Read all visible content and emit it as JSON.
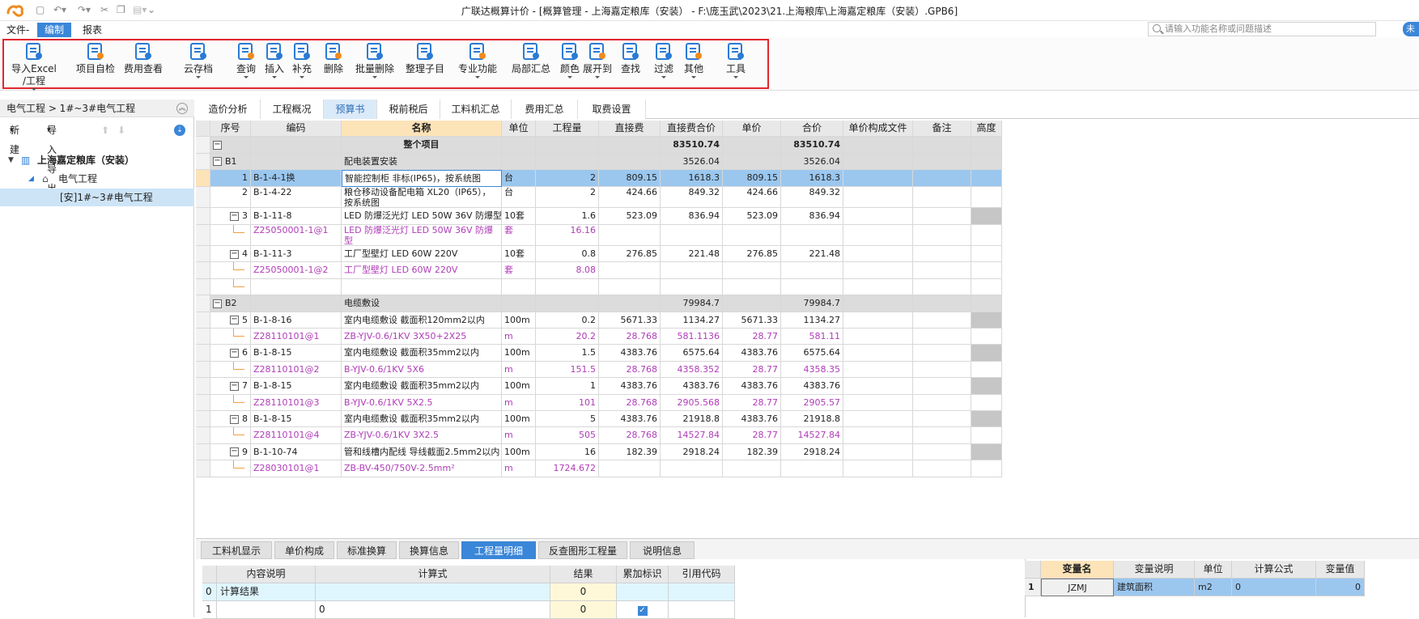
{
  "app": {
    "window_title": "广联达概算计价 - [概算管理 - 上海嘉定粮库（安装） - F:\\庞玉武\\2023\\21.上海粮库\\上海嘉定粮库（安装）.GPB6]"
  },
  "menubar": {
    "items": [
      "文件-",
      "编制",
      "报表"
    ],
    "active": "编制",
    "search_placeholder": "请输入功能名称或问题描述",
    "user_label": "未"
  },
  "ribbon": {
    "tools": [
      {
        "label": "导入Excel",
        "label2": "/工程",
        "icon": "import-excel-icon",
        "color": "#2a7bd5",
        "dropdown": true
      },
      {
        "label": "项目自检",
        "icon": "check-icon",
        "color": "#2a7bd5",
        "dropdown": false
      },
      {
        "label": "费用查看",
        "icon": "fee-view-icon",
        "color": "#2a7bd5",
        "dropdown": false
      },
      {
        "label": "云存档",
        "icon": "cloud-icon",
        "color": "#2a7bd5",
        "dropdown": true
      },
      {
        "label": "查询",
        "icon": "query-icon",
        "color": "#2a7bd5",
        "dropdown": true
      },
      {
        "label": "插入",
        "icon": "insert-icon",
        "color": "#2a7bd5",
        "dropdown": true
      },
      {
        "label": "补充",
        "icon": "supplement-icon",
        "color": "#2a7bd5",
        "dropdown": true
      },
      {
        "label": "删除",
        "icon": "delete-icon",
        "color": "#2a7bd5",
        "dropdown": false
      },
      {
        "label": "批量删除",
        "icon": "batch-delete-icon",
        "color": "#2a7bd5",
        "dropdown": true
      },
      {
        "label": "整理子目",
        "icon": "organize-icon",
        "color": "#2a7bd5",
        "dropdown": false
      },
      {
        "label": "专业功能",
        "icon": "professional-icon",
        "color": "#2a7bd5",
        "dropdown": true
      },
      {
        "label": "局部汇总",
        "icon": "partial-summary-icon",
        "color": "#2a7bd5",
        "dropdown": false
      },
      {
        "label": "颜色",
        "icon": "color-icon",
        "color": "#2a7bd5",
        "dropdown": true
      },
      {
        "label": "展开到",
        "icon": "expand-to-icon",
        "color": "#2a7bd5",
        "dropdown": true
      },
      {
        "label": "查找",
        "icon": "find-icon",
        "color": "#2a7bd5",
        "dropdown": false
      },
      {
        "label": "过滤",
        "icon": "filter-icon",
        "color": "#2a7bd5",
        "dropdown": true
      },
      {
        "label": "其他",
        "icon": "other-icon",
        "color": "#2a7bd5",
        "dropdown": true
      },
      {
        "label": "工具",
        "icon": "tools-icon",
        "color": "#2a7bd5",
        "dropdown": true
      }
    ]
  },
  "left_pane": {
    "breadcrumb": "电气工程 > 1#~3#电气工程",
    "new_label": "新建",
    "import_export_label": "导入导出",
    "tree": [
      {
        "label": "上海嘉定粮库（安装）",
        "level": 0,
        "bold": true,
        "icon": "building-icon"
      },
      {
        "label": "电气工程",
        "level": 1,
        "bold": false,
        "icon": "home-icon"
      },
      {
        "label": "[安]1#~3#电气工程",
        "level": 2,
        "bold": false,
        "icon": ""
      }
    ]
  },
  "tabs": [
    {
      "label": "造价分析"
    },
    {
      "label": "工程概况"
    },
    {
      "label": "预算书"
    },
    {
      "label": "税前税后"
    },
    {
      "label": "工料机汇总"
    },
    {
      "label": "费用汇总"
    },
    {
      "label": "取费设置"
    }
  ],
  "tabs_active": "预算书",
  "grid": {
    "headers": [
      "",
      "序号",
      "编码",
      "名称",
      "单位",
      "工程量",
      "直接费",
      "直接费合价",
      "单价",
      "合价",
      "单价构成文件",
      "备注",
      "高度"
    ],
    "rows": [
      {
        "type": "root",
        "seq": "",
        "code": "",
        "name": "整个项目",
        "unit": "",
        "qty": "",
        "direct": "",
        "direct_total": "83510.74",
        "price": "",
        "total": "83510.74"
      },
      {
        "type": "section",
        "seq": "B1",
        "code": "",
        "name": "配电装置安装",
        "unit": "",
        "qty": "",
        "direct": "",
        "direct_total": "3526.04",
        "price": "",
        "total": "3526.04"
      },
      {
        "type": "item",
        "selected": true,
        "seq": "1",
        "code": "B-1-4-1换",
        "name": "智能控制柜 非标(IP65)，按系统图",
        "unit": "台",
        "qty": "2",
        "direct": "809.15",
        "direct_total": "1618.3",
        "price": "809.15",
        "total": "1618.3"
      },
      {
        "type": "item",
        "seq": "2",
        "code": "B-1-4-22",
        "name": "粮仓移动设备配电箱 XL20（IP65），按系统图",
        "unit": "台",
        "qty": "2",
        "direct": "424.66",
        "direct_total": "849.32",
        "price": "424.66",
        "total": "849.32",
        "tall": true
      },
      {
        "type": "item",
        "seq": "3",
        "code": "B-1-11-8",
        "name": "LED 防爆泛光灯 LED 50W 36V 防爆型",
        "unit": "10套",
        "qty": "1.6",
        "direct": "523.09",
        "direct_total": "836.94",
        "price": "523.09",
        "total": "836.94"
      },
      {
        "type": "sub",
        "seq": "",
        "code": "Z25050001-1@1",
        "name": "LED 防爆泛光灯 LED 50W 36V 防爆型",
        "unit": "套",
        "qty": "16.16",
        "direct": "",
        "direct_total": "",
        "price": "",
        "total": "",
        "tall": true
      },
      {
        "type": "item",
        "seq": "4",
        "code": "B-1-11-3",
        "name": "工厂型壁灯 LED 60W 220V",
        "unit": "10套",
        "qty": "0.8",
        "direct": "276.85",
        "direct_total": "221.48",
        "price": "276.85",
        "total": "221.48"
      },
      {
        "type": "sub",
        "seq": "",
        "code": "Z25050001-1@2",
        "name": "工厂型壁灯 LED 60W 220V",
        "unit": "套",
        "qty": "8.08",
        "direct": "",
        "direct_total": "",
        "price": "",
        "total": ""
      },
      {
        "type": "blank",
        "seq": "",
        "code": "",
        "name": "",
        "unit": "",
        "qty": "",
        "direct": "",
        "direct_total": "",
        "price": "",
        "total": ""
      },
      {
        "type": "section",
        "seq": "B2",
        "code": "",
        "name": "电缆敷设",
        "unit": "",
        "qty": "",
        "direct": "",
        "direct_total": "79984.7",
        "price": "",
        "total": "79984.7"
      },
      {
        "type": "item",
        "seq": "5",
        "code": "B-1-8-16",
        "name": "室内电缆敷设 截面积120mm2以内",
        "unit": "100m",
        "qty": "0.2",
        "direct": "5671.33",
        "direct_total": "1134.27",
        "price": "5671.33",
        "total": "1134.27"
      },
      {
        "type": "sub",
        "seq": "",
        "code": "Z28110101@1",
        "name": "ZB-YJV-0.6/1KV 3X50+2X25",
        "unit": "m",
        "qty": "20.2",
        "direct": "28.768",
        "direct_total": "581.1136",
        "price": "28.77",
        "total": "581.11"
      },
      {
        "type": "item",
        "seq": "6",
        "code": "B-1-8-15",
        "name": "室内电缆敷设 截面积35mm2以内",
        "unit": "100m",
        "qty": "1.5",
        "direct": "4383.76",
        "direct_total": "6575.64",
        "price": "4383.76",
        "total": "6575.64"
      },
      {
        "type": "sub",
        "seq": "",
        "code": "Z28110101@2",
        "name": "B-YJV-0.6/1KV 5X6",
        "unit": "m",
        "qty": "151.5",
        "direct": "28.768",
        "direct_total": "4358.352",
        "price": "28.77",
        "total": "4358.35"
      },
      {
        "type": "item",
        "seq": "7",
        "code": "B-1-8-15",
        "name": "室内电缆敷设 截面积35mm2以内",
        "unit": "100m",
        "qty": "1",
        "direct": "4383.76",
        "direct_total": "4383.76",
        "price": "4383.76",
        "total": "4383.76"
      },
      {
        "type": "sub",
        "seq": "",
        "code": "Z28110101@3",
        "name": "B-YJV-0.6/1KV 5X2.5",
        "unit": "m",
        "qty": "101",
        "direct": "28.768",
        "direct_total": "2905.568",
        "price": "28.77",
        "total": "2905.57"
      },
      {
        "type": "item",
        "seq": "8",
        "code": "B-1-8-15",
        "name": "室内电缆敷设 截面积35mm2以内",
        "unit": "100m",
        "qty": "5",
        "direct": "4383.76",
        "direct_total": "21918.8",
        "price": "4383.76",
        "total": "21918.8"
      },
      {
        "type": "sub",
        "seq": "",
        "code": "Z28110101@4",
        "name": "ZB-YJV-0.6/1KV 3X2.5",
        "unit": "m",
        "qty": "505",
        "direct": "28.768",
        "direct_total": "14527.84",
        "price": "28.77",
        "total": "14527.84"
      },
      {
        "type": "item",
        "seq": "9",
        "code": "B-1-10-74",
        "name": "管和线槽内配线 导线截面2.5mm2以内",
        "unit": "100m",
        "qty": "16",
        "direct": "182.39",
        "direct_total": "2918.24",
        "price": "182.39",
        "total": "2918.24"
      },
      {
        "type": "sub",
        "seq": "",
        "code": "Z28030101@1",
        "name": "ZB-BV-450/750V-2.5mm²",
        "unit": "m",
        "qty": "1724.672",
        "direct": "",
        "direct_total": "",
        "price": "",
        "total": ""
      }
    ]
  },
  "bottom_tabs": [
    {
      "label": "工料机显示"
    },
    {
      "label": "单价构成"
    },
    {
      "label": "标准换算"
    },
    {
      "label": "换算信息"
    },
    {
      "label": "工程量明细"
    },
    {
      "label": "反查图形工程量"
    },
    {
      "label": "说明信息"
    }
  ],
  "bottom_tabs_active": "工程量明细",
  "detail_table": {
    "headers": [
      "",
      "内容说明",
      "计算式",
      "结果",
      "累加标识",
      "引用代码"
    ],
    "rows": [
      {
        "idx": "0",
        "desc": "计算结果",
        "formula": "",
        "result": "0",
        "accumulate": false,
        "ref": ""
      },
      {
        "idx": "1",
        "desc": "",
        "formula": "0",
        "result": "0",
        "accumulate": true,
        "ref": ""
      }
    ]
  },
  "variable_table": {
    "headers": [
      "",
      "变量名",
      "变量说明",
      "单位",
      "计算公式",
      "变量值"
    ],
    "rows": [
      {
        "idx": "1",
        "name": "JZMJ",
        "desc": "建筑面积",
        "unit": "m2",
        "formula": "0",
        "value": "0"
      }
    ]
  },
  "colors": {
    "accent": "#3a86d8",
    "highlight_box": "#e0262f",
    "sub_item_text": "#b03cb8",
    "selected_row": "#9bc7ef",
    "section_row": "#dcdcdc"
  }
}
